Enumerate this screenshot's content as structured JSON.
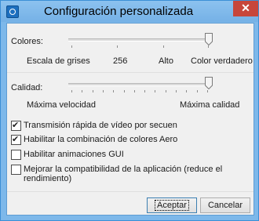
{
  "window": {
    "title": "Configuración personalizada",
    "close_glyph": "✕"
  },
  "colores": {
    "label": "Colores:",
    "ticks": [
      "Escala de grises",
      "256",
      "Alto",
      "Color verdadero"
    ],
    "value": "Color verdadero"
  },
  "calidad": {
    "label": "Calidad:",
    "left_label": "Máxima velocidad",
    "right_label": "Máxima calidad",
    "value": "Máxima calidad"
  },
  "options": [
    {
      "label": "Transmisión rápida de vídeo por secuen",
      "checked": true
    },
    {
      "label": "Habilitar la combinación de colores Aero",
      "checked": true
    },
    {
      "label": "Habilitar animaciones GUI",
      "checked": false
    },
    {
      "label": "Mejorar la compatibilidad de la aplicación (reduce el",
      "label2": "rendimiento)",
      "checked": false
    }
  ],
  "buttons": {
    "accept": "Aceptar",
    "cancel": "Cancelar"
  },
  "icons": {
    "app": "remote-desktop-icon",
    "close": "close-icon"
  }
}
